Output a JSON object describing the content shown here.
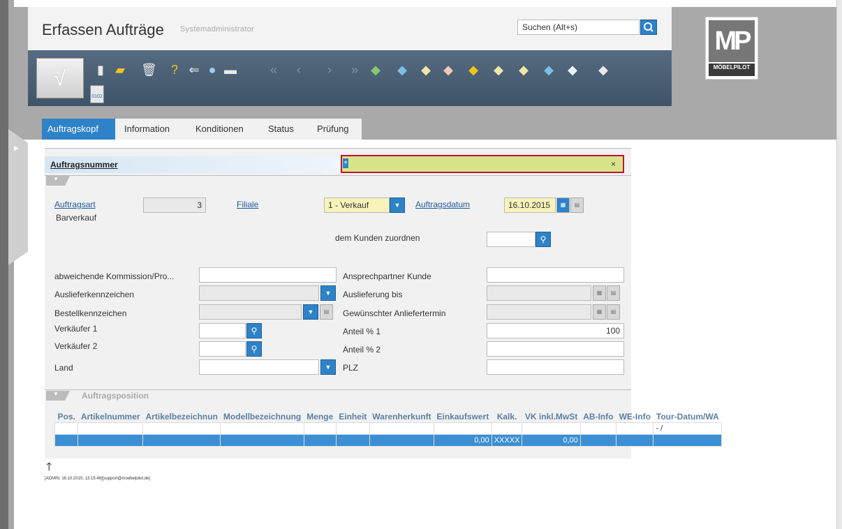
{
  "app": {
    "title": "Erfassen Aufträge",
    "user": "Systemadministrator"
  },
  "search": {
    "placeholder": "Suchen (Alt+s)"
  },
  "logo": {
    "text": "MP",
    "brand": "MÖBELPILOT"
  },
  "toolbar": {
    "counter_label": "0102"
  },
  "tabs": [
    "Auftragskopf",
    "Information",
    "Konditionen",
    "Status",
    "Prüfung"
  ],
  "order": {
    "label": "Auftragsnummer",
    "value": "+"
  },
  "form": {
    "auftragsart_label": "Auftragsart",
    "auftragsart_value": "3",
    "auftragsart_desc": "Barverkauf",
    "filiale_label": "Filiale",
    "filiale_value": "1 - Verkauf",
    "auftragsdatum_label": "Auftragsdatum",
    "auftragsdatum_value": "16.10.2015",
    "kunde_label": "dem Kunden zuordnen",
    "kommission_label": "abweichende Kommission/Pro...",
    "ansprechpartner_label": "Ansprechpartner Kunde",
    "auslieferkennzeichen_label": "Auslieferkennzeichen",
    "auslieferung_bis_label": "Auslieferung bis",
    "bestellkennzeichen_label": "Bestellkennzeichen",
    "anliefertermin_label": "Gewünschter Anliefertermin",
    "verkaeufer1_label": "Verkäufer 1",
    "anteil1_label": "Anteil % 1",
    "anteil1_value": "100",
    "verkaeufer2_label": "Verkäufer 2",
    "anteil2_label": "Anteil % 2",
    "land_label": "Land",
    "plz_label": "PLZ"
  },
  "positions": {
    "section_title": "Auftragsposition",
    "columns": [
      "Pos.",
      "Artikelnummer",
      "Artikelbezeichnun",
      "Modellbezeichnung",
      "Menge",
      "Einheit",
      "Warenherkunft",
      "Einkaufswert",
      "Kalk.",
      "VK inkl.MwSt",
      "AB-Info",
      "WE-Info",
      "Tour-Datum/WA"
    ],
    "row1_tour": "- /",
    "sum_einkaufswert": "0,00",
    "sum_kalk": "XXXXX",
    "sum_vk": "0,00"
  },
  "footer": {
    "text": "[ADMIN, 16.10.2015, 13:15:46][support@moebelpilot.de]"
  },
  "colors": {
    "accent": "#2e82c8",
    "highlight_field": "#d7e58a",
    "focus_border": "#c8102e"
  }
}
